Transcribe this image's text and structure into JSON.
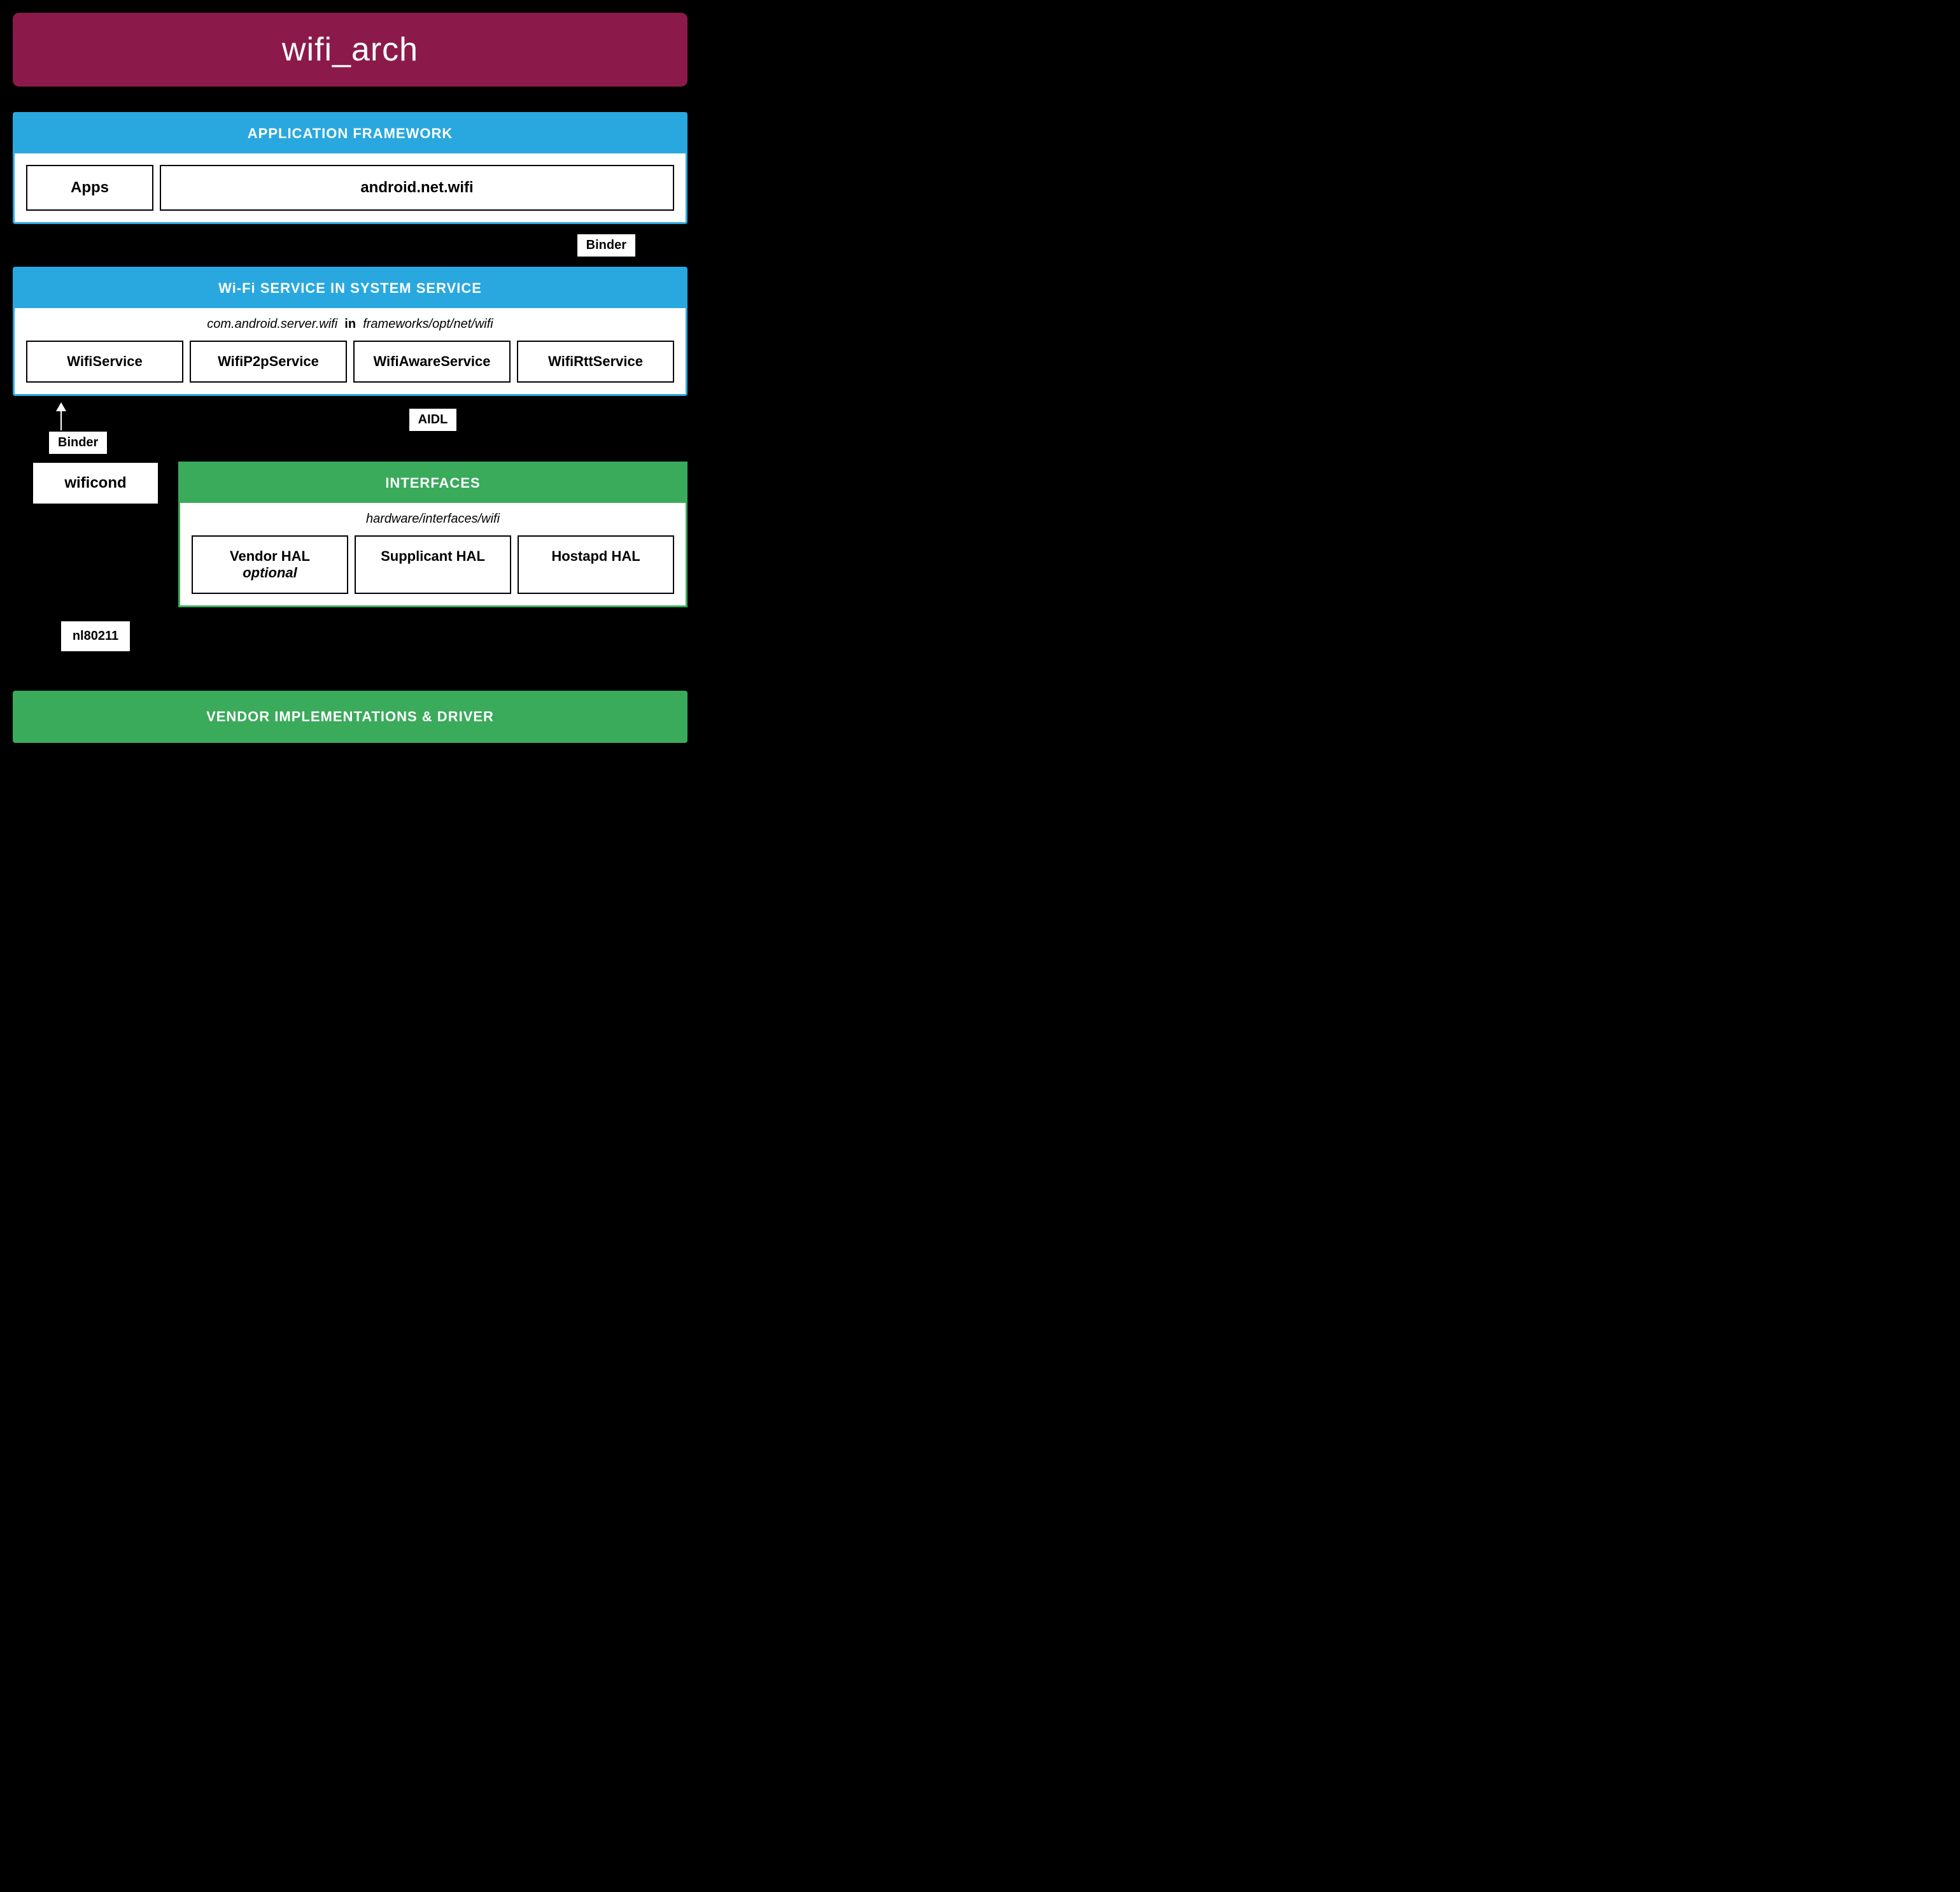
{
  "title": "wifi_arch",
  "app_framework": {
    "header": "APPLICATION FRAMEWORK",
    "apps_label": "Apps",
    "android_wifi_label": "android.net.wifi"
  },
  "binder_top": "Binder",
  "wifi_service": {
    "header": "Wi-Fi SERVICE IN SYSTEM SERVICE",
    "path_pre": "com.android.server.wifi",
    "path_bold": "in",
    "path_post": "frameworks/opt/net/wifi",
    "wifi_service_label": "WifiService",
    "wifi_p2p_label": "WifiP2pService",
    "wifi_aware_label": "WifiAwareService",
    "wifi_rtt_label": "WifiRttService"
  },
  "binder_left": "Binder",
  "aidl_label": "AIDL",
  "wificond_label": "wificond",
  "interfaces": {
    "header": "INTERFACES",
    "path": "hardware/interfaces/wifi",
    "vendor_hal_label": "Vendor HAL (optional)",
    "supplicant_hal_label": "Supplicant HAL",
    "hostapd_hal_label": "Hostapd HAL"
  },
  "nl80211_label": "nl80211",
  "vendor_bar": "VENDOR IMPLEMENTATIONS & DRIVER"
}
